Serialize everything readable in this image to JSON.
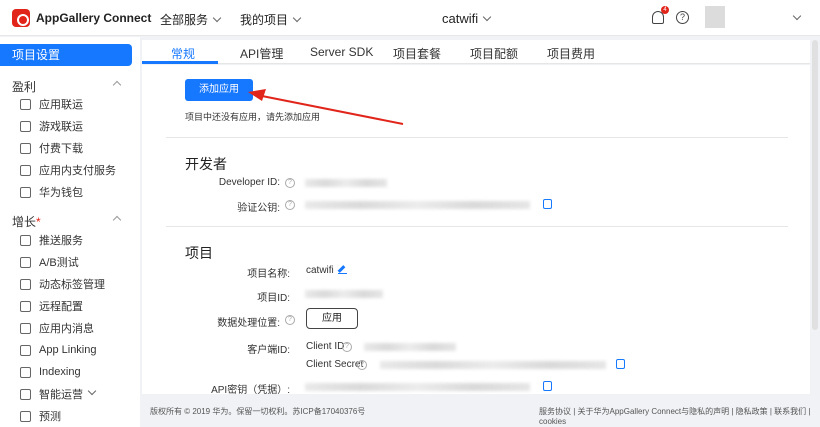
{
  "header": {
    "brand": "AppGallery Connect",
    "all_services": "全部服务",
    "my_projects": "我的项目",
    "project_name": "catwifi",
    "notifications_count": "4",
    "help": "?"
  },
  "sidebar": {
    "active_item": "项目设置",
    "groups": [
      {
        "label": "盈利",
        "items": [
          "应用联运",
          "游戏联运",
          "付费下载",
          "应用内支付服务",
          "华为钱包"
        ]
      },
      {
        "label": "增长",
        "mark": "*",
        "items": [
          "推送服务",
          "A/B测试",
          "动态标签管理",
          "远程配置",
          "应用内消息",
          "App Linking",
          "Indexing",
          "智能运营",
          "预测"
        ]
      }
    ]
  },
  "tabs": [
    "常规",
    "API管理",
    "Server SDK",
    "项目套餐",
    "项目配额",
    "项目费用"
  ],
  "active_tab": "常规",
  "main": {
    "add_app_button": "添加应用",
    "empty_message": "项目中还没有应用，请先添加应用",
    "developer_section": {
      "title": "开发者",
      "developer_id_label": "Developer ID:",
      "verify_key_label": "验证公钥:"
    },
    "project_section": {
      "title": "项目",
      "name_label": "项目名称:",
      "name_value": "catwifi",
      "id_label": "项目ID:",
      "data_location_label": "数据处理位置:",
      "apply_button": "应用",
      "client_id_group_label": "客户端ID:",
      "client_id_label": "Client ID",
      "client_secret_label": "Client Secret",
      "api_key_label": "API密钥（凭据）:"
    }
  },
  "footer": {
    "left": "版权所有 © 2019 华为。保留一切权利。苏ICP备17040376号",
    "right": "服务协议 | 关于华为AppGallery Connect与隐私的声明 | 隐私政策 | 联系我们 | cookies"
  },
  "colors": {
    "accent": "#1677ff",
    "annotation_arrow": "#e1251b"
  }
}
